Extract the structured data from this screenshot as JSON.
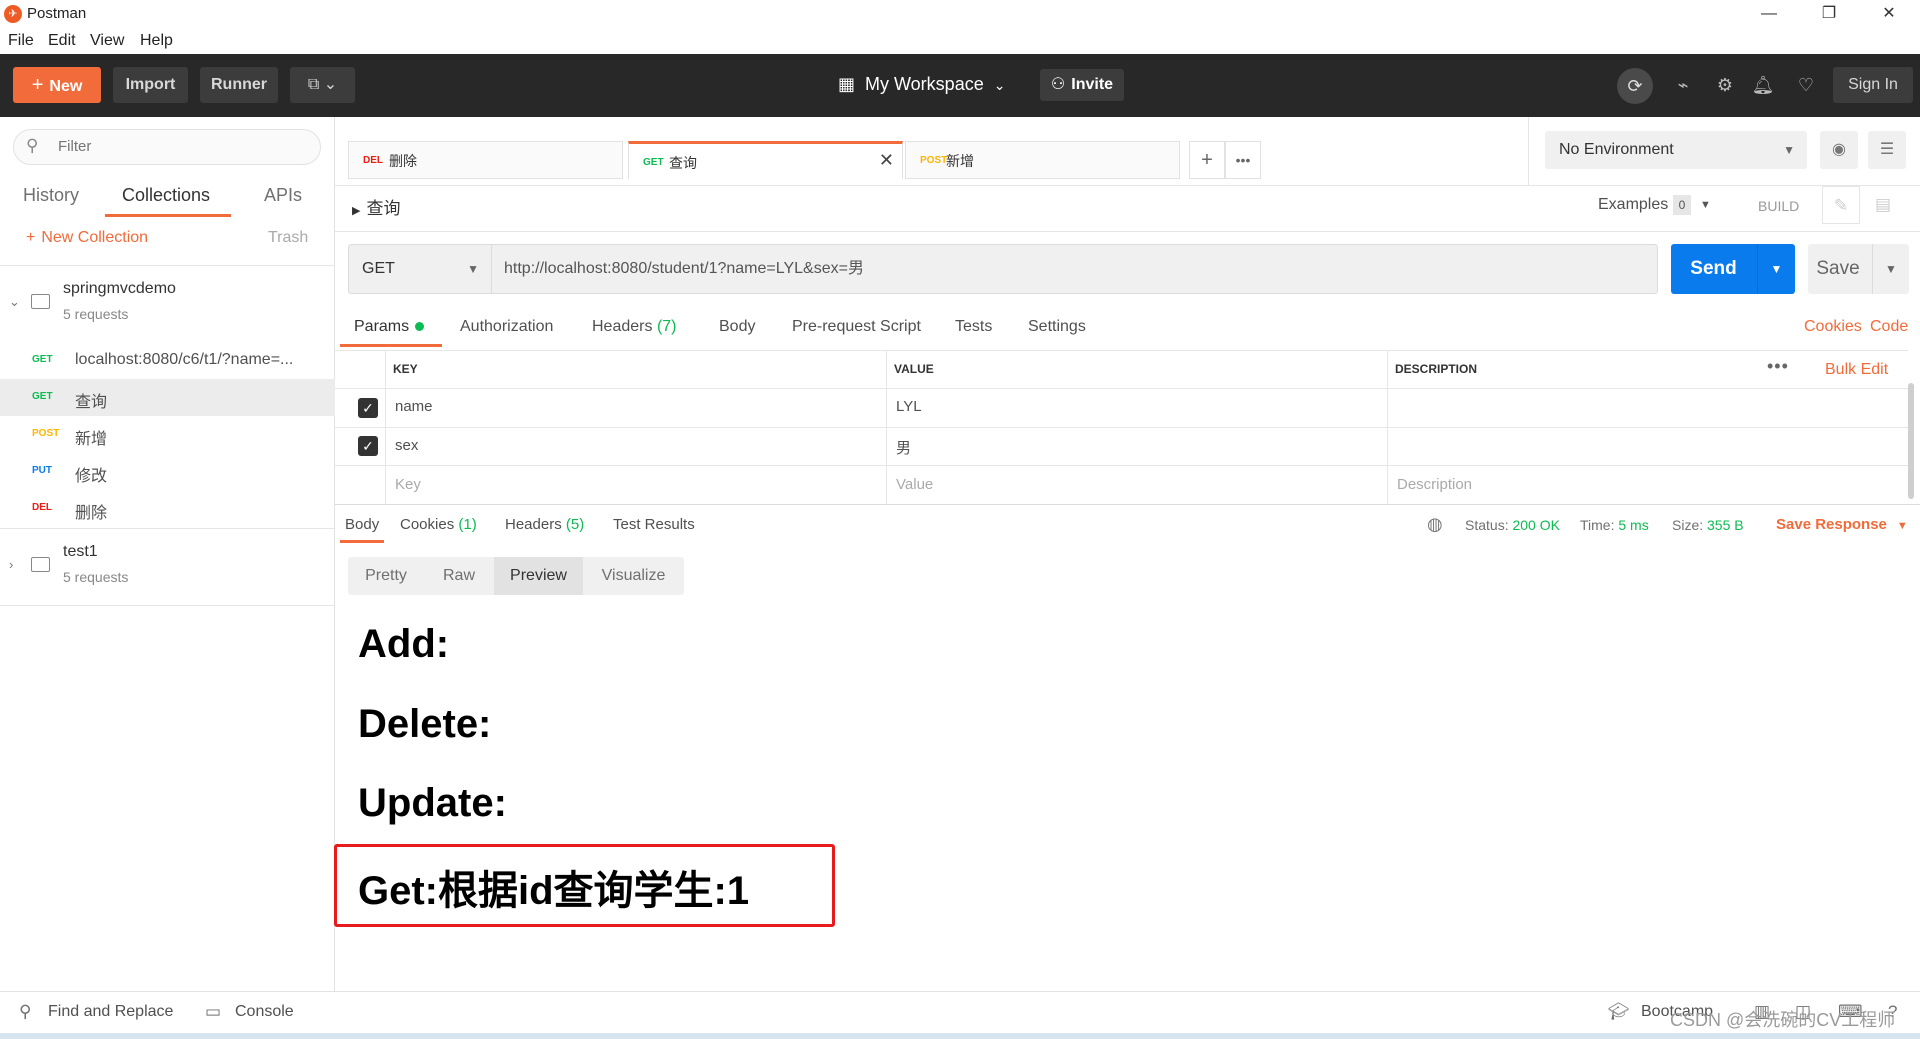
{
  "window": {
    "title": "Postman",
    "controls": {
      "minimize": "—",
      "restore": "❐",
      "close": "✕"
    }
  },
  "menu": [
    "File",
    "Edit",
    "View",
    "Help"
  ],
  "header": {
    "new_label": "New",
    "import_label": "Import",
    "runner_label": "Runner",
    "workspace_label": "My Workspace",
    "invite_label": "Invite",
    "signin_label": "Sign In"
  },
  "sidebar": {
    "filter_placeholder": "Filter",
    "tabs": [
      "History",
      "Collections",
      "APIs"
    ],
    "active_tab": "Collections",
    "new_collection_label": "New Collection",
    "trash_label": "Trash",
    "collections": [
      {
        "name": "springmvcdemo",
        "count": "5 requests",
        "expanded": true,
        "requests": [
          {
            "method": "GET",
            "name": "localhost:8080/c6/t1/?name=..."
          },
          {
            "method": "GET",
            "name": "查询",
            "selected": true
          },
          {
            "method": "POST",
            "name": "新增"
          },
          {
            "method": "PUT",
            "name": "修改"
          },
          {
            "method": "DEL",
            "name": "删除"
          }
        ]
      },
      {
        "name": "test1",
        "count": "5 requests",
        "expanded": false
      }
    ]
  },
  "tabs": [
    {
      "method": "DEL",
      "name": "删除"
    },
    {
      "method": "GET",
      "name": "查询",
      "active": true
    },
    {
      "method": "POST",
      "name": "新增"
    }
  ],
  "environment": {
    "selected": "No Environment"
  },
  "request": {
    "name": "查询",
    "examples_label": "Examples",
    "examples_count": "0",
    "build_label": "BUILD",
    "method": "GET",
    "url": "http://localhost:8080/student/1?name=LYL&sex=男",
    "send_label": "Send",
    "save_label": "Save",
    "subtabs": {
      "params": "Params",
      "authorization": "Authorization",
      "headers": "Headers",
      "headers_count": "(7)",
      "body": "Body",
      "prerequest": "Pre-request Script",
      "tests": "Tests",
      "settings": "Settings"
    },
    "cookies_label": "Cookies",
    "code_label": "Code",
    "params_table": {
      "columns": [
        "KEY",
        "VALUE",
        "DESCRIPTION"
      ],
      "bulk_edit_label": "Bulk Edit",
      "rows": [
        {
          "checked": true,
          "key": "name",
          "value": "LYL",
          "description": ""
        },
        {
          "checked": true,
          "key": "sex",
          "value": "男",
          "description": ""
        }
      ],
      "placeholder": {
        "key": "Key",
        "value": "Value",
        "description": "Description"
      }
    }
  },
  "response": {
    "tabs": {
      "body": "Body",
      "cookies": "Cookies",
      "cookies_count": "(1)",
      "headers": "Headers",
      "headers_count": "(5)",
      "tests": "Test Results"
    },
    "status_label": "Status:",
    "status_value": "200 OK",
    "time_label": "Time:",
    "time_value": "5 ms",
    "size_label": "Size:",
    "size_value": "355 B",
    "save_response_label": "Save Response",
    "view_modes": [
      "Pretty",
      "Raw",
      "Preview",
      "Visualize"
    ],
    "active_view_mode": "Preview",
    "preview_lines": [
      "Add:",
      "Delete:",
      "Update:",
      "Get:根据id查询学生:1"
    ],
    "highlight_color": "#e81b1b"
  },
  "footer": {
    "find_replace_label": "Find and Replace",
    "console_label": "Console",
    "bootcamp_label": "Bootcamp",
    "watermark": "CSDN @会洗碗的CV工程师"
  },
  "colors": {
    "accent": "#f26b3a",
    "send_blue": "#097bed",
    "get": "#0cbb52",
    "post": "#ffb400",
    "put": "#097bed",
    "del": "#eb2013"
  }
}
